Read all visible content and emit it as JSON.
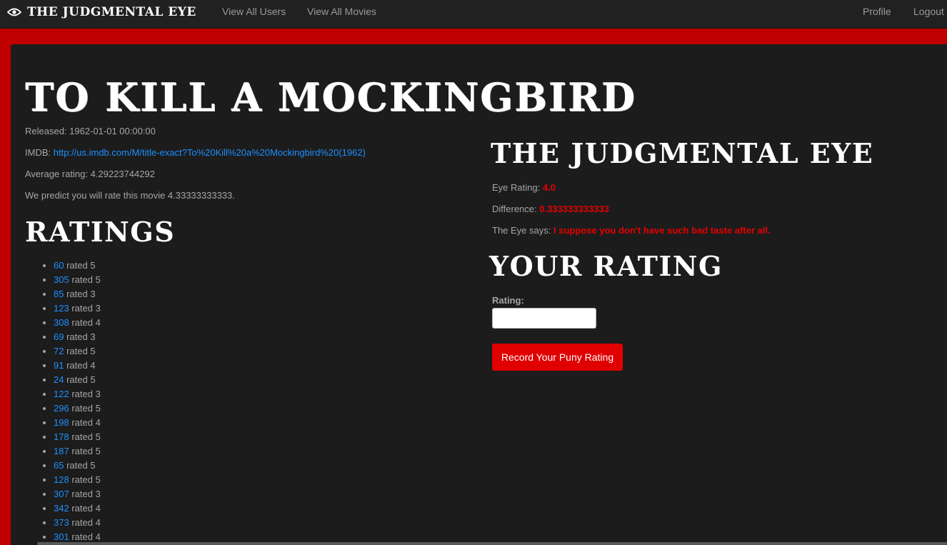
{
  "nav": {
    "brand": "The Judgmental Eye",
    "links": [
      "View All Users",
      "View All Movies"
    ],
    "profile": "Profile",
    "logout": "Logout"
  },
  "movie": {
    "title": "To Kill a Mockingbird",
    "released_label": "Released:",
    "released": "1962-01-01 00:00:00",
    "imdb_label": "IMDB:",
    "imdb_url": "http://us.imdb.com/M/title-exact?To%20Kill%20a%20Mockingbird%20(1962)",
    "avg_label": "Average rating:",
    "avg_rating": "4.29223744292",
    "predict_text": "We predict you will rate this movie 4.33333333333."
  },
  "ratings": {
    "heading": "Ratings",
    "rated_word": "rated",
    "items": [
      {
        "user": "60",
        "score": "5"
      },
      {
        "user": "305",
        "score": "5"
      },
      {
        "user": "85",
        "score": "3"
      },
      {
        "user": "123",
        "score": "3"
      },
      {
        "user": "308",
        "score": "4"
      },
      {
        "user": "69",
        "score": "3"
      },
      {
        "user": "72",
        "score": "5"
      },
      {
        "user": "91",
        "score": "4"
      },
      {
        "user": "24",
        "score": "5"
      },
      {
        "user": "122",
        "score": "3"
      },
      {
        "user": "296",
        "score": "5"
      },
      {
        "user": "198",
        "score": "4"
      },
      {
        "user": "178",
        "score": "5"
      },
      {
        "user": "187",
        "score": "5"
      },
      {
        "user": "65",
        "score": "5"
      },
      {
        "user": "128",
        "score": "5"
      },
      {
        "user": "307",
        "score": "3"
      },
      {
        "user": "342",
        "score": "4"
      },
      {
        "user": "373",
        "score": "4"
      },
      {
        "user": "301",
        "score": "4"
      }
    ]
  },
  "eye": {
    "heading": "The Judgmental Eye",
    "rating_label": "Eye Rating:",
    "rating": "4.0",
    "difference_label": "Difference:",
    "difference": "0.333333333333",
    "says_label": "The Eye says:",
    "says": "I suppose you don't have such bad taste after all."
  },
  "your_rating": {
    "heading": "Your Rating",
    "label": "Rating:",
    "value": "",
    "button": "Record Your Puny Rating"
  },
  "colors": {
    "accent_red": "#e00000",
    "link_blue": "#1e90ff"
  }
}
